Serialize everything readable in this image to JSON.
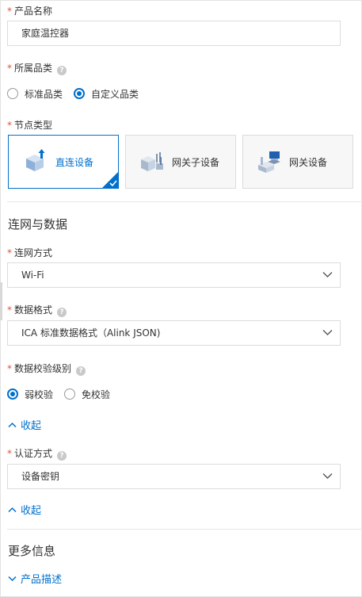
{
  "colors": {
    "accent": "#0070cc",
    "required": "#e0523b",
    "border": "#dcdcdc"
  },
  "product_name": {
    "label": "产品名称",
    "value": "家庭温控器"
  },
  "category": {
    "label": "所属品类",
    "options": [
      {
        "label": "标准品类",
        "selected": false
      },
      {
        "label": "自定义品类",
        "selected": true
      }
    ]
  },
  "node_type": {
    "label": "节点类型",
    "cards": [
      {
        "label": "直连设备",
        "icon": "direct-device-icon",
        "selected": true
      },
      {
        "label": "网关子设备",
        "icon": "gateway-subdevice-icon",
        "selected": false
      },
      {
        "label": "网关设备",
        "icon": "gateway-device-icon",
        "selected": false
      }
    ]
  },
  "network_section": {
    "title": "连网与数据"
  },
  "network_method": {
    "label": "连网方式",
    "value": "Wi-Fi"
  },
  "data_format": {
    "label": "数据格式",
    "value": "ICA 标准数据格式（Alink JSON)"
  },
  "validation_level": {
    "label": "数据校验级别",
    "options": [
      {
        "label": "弱校验",
        "selected": true
      },
      {
        "label": "免校验",
        "selected": false
      }
    ]
  },
  "collapse_1": {
    "label": "收起"
  },
  "auth_method": {
    "label": "认证方式",
    "value": "设备密钥"
  },
  "collapse_2": {
    "label": "收起"
  },
  "more_section": {
    "title": "更多信息"
  },
  "product_desc": {
    "label": "产品描述"
  }
}
